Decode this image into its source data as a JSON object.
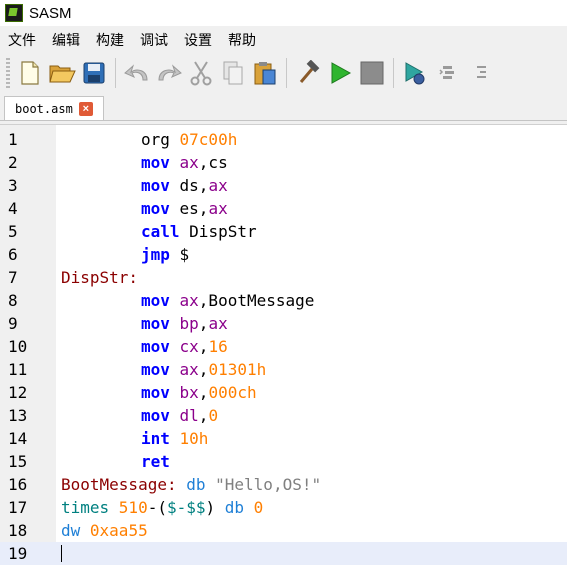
{
  "window": {
    "title": "SASM"
  },
  "menu": [
    "文件",
    "编辑",
    "构建",
    "调试",
    "设置",
    "帮助"
  ],
  "toolbar": {
    "buttons": [
      "new-file",
      "open-file",
      "save-file",
      "undo",
      "redo",
      "cut",
      "copy",
      "paste",
      "build",
      "run",
      "stop",
      "debug",
      "step-over",
      "step-into"
    ]
  },
  "tab": {
    "label": "boot.asm",
    "close": "×"
  },
  "editor": {
    "line_numbers": [
      "1",
      "2",
      "3",
      "4",
      "5",
      "6",
      "7",
      "8",
      "9",
      "10",
      "11",
      "12",
      "13",
      "14",
      "15",
      "16",
      "17",
      "18",
      "19"
    ],
    "lines": [
      {
        "indent": true,
        "tokens": [
          [
            "pl",
            "org "
          ],
          [
            "num",
            "07c00h"
          ]
        ]
      },
      {
        "indent": true,
        "tokens": [
          [
            "kw",
            "mov "
          ],
          [
            "reg",
            "ax"
          ],
          [
            "pl",
            ",cs"
          ]
        ]
      },
      {
        "indent": true,
        "tokens": [
          [
            "kw",
            "mov "
          ],
          [
            "pl",
            "ds,"
          ],
          [
            "reg",
            "ax"
          ]
        ]
      },
      {
        "indent": true,
        "tokens": [
          [
            "kw",
            "mov "
          ],
          [
            "pl",
            "es,"
          ],
          [
            "reg",
            "ax"
          ]
        ]
      },
      {
        "indent": true,
        "tokens": [
          [
            "kw",
            "call "
          ],
          [
            "pl",
            "DispStr"
          ]
        ]
      },
      {
        "indent": true,
        "tokens": [
          [
            "kw",
            "jmp "
          ],
          [
            "pl",
            "$"
          ]
        ]
      },
      {
        "indent": false,
        "tokens": [
          [
            "lbl",
            "DispStr:"
          ]
        ]
      },
      {
        "indent": true,
        "tokens": [
          [
            "kw",
            "mov "
          ],
          [
            "reg",
            "ax"
          ],
          [
            "pl",
            ",BootMessage"
          ]
        ]
      },
      {
        "indent": true,
        "tokens": [
          [
            "kw",
            "mov "
          ],
          [
            "reg",
            "bp"
          ],
          [
            "pl",
            ","
          ],
          [
            "reg",
            "ax"
          ]
        ]
      },
      {
        "indent": true,
        "tokens": [
          [
            "kw",
            "mov "
          ],
          [
            "reg",
            "cx"
          ],
          [
            "pl",
            ","
          ],
          [
            "num",
            "16"
          ]
        ]
      },
      {
        "indent": true,
        "tokens": [
          [
            "kw",
            "mov "
          ],
          [
            "reg",
            "ax"
          ],
          [
            "pl",
            ","
          ],
          [
            "num",
            "01301h"
          ]
        ]
      },
      {
        "indent": true,
        "tokens": [
          [
            "kw",
            "mov "
          ],
          [
            "reg",
            "bx"
          ],
          [
            "pl",
            ","
          ],
          [
            "num",
            "000ch"
          ]
        ]
      },
      {
        "indent": true,
        "tokens": [
          [
            "kw",
            "mov "
          ],
          [
            "reg",
            "dl"
          ],
          [
            "pl",
            ","
          ],
          [
            "num",
            "0"
          ]
        ]
      },
      {
        "indent": true,
        "tokens": [
          [
            "kw",
            "int "
          ],
          [
            "num",
            "10h"
          ]
        ]
      },
      {
        "indent": true,
        "tokens": [
          [
            "kw",
            "ret"
          ]
        ]
      },
      {
        "indent": false,
        "tokens": [
          [
            "lbl",
            "BootMessage: "
          ],
          [
            "dir",
            "db "
          ],
          [
            "str",
            "\"Hello,OS!\""
          ]
        ]
      },
      {
        "indent": false,
        "tokens": [
          [
            "tms",
            "times "
          ],
          [
            "num",
            "510"
          ],
          [
            "pl",
            "-("
          ],
          [
            "sym",
            "$-$$"
          ],
          [
            "pl",
            ") "
          ],
          [
            "dir",
            "db "
          ],
          [
            "num",
            "0"
          ]
        ]
      },
      {
        "indent": false,
        "tokens": [
          [
            "dir",
            "dw "
          ],
          [
            "num",
            "0xaa55"
          ]
        ]
      },
      {
        "indent": false,
        "tokens": []
      }
    ],
    "current_line": 19
  },
  "colors": {
    "keyword": "#0000ff",
    "register": "#8b008b",
    "number": "#ff7f00",
    "label": "#8b0000",
    "directive": "#1e7fd6",
    "current_line": "#e8edfa"
  }
}
